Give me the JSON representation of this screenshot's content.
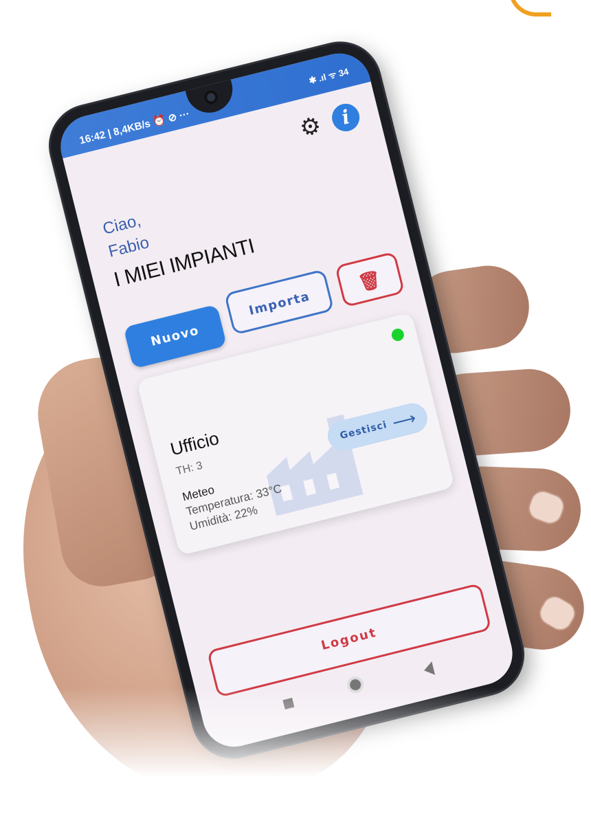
{
  "statusbar": {
    "time": "16:42 | 8,4KB/s ⏰ ⊘ ···",
    "icons": "✱ .ıl ᯤ 34"
  },
  "header": {
    "settings_icon": "gear-icon",
    "info_icon": "info-icon",
    "info_glyph": "i"
  },
  "greeting": {
    "hello": "Ciao,",
    "user": "Fabio"
  },
  "page_title": "I MIEI IMPIANTI",
  "actions": {
    "new_label": "Nuovo",
    "import_label": "Importa",
    "delete_icon": "trash-icon",
    "delete_glyph": "🗑"
  },
  "plants": [
    {
      "name": "Ufficio",
      "th": "TH: 3",
      "meteo_label": "Meteo",
      "temperature": "Temperatura: 33°C",
      "humidity": "Umidità: 22%",
      "status_color": "#19d32c",
      "manage_label": "Gestisci",
      "manage_arrow": "⟶"
    }
  ],
  "logout_label": "Logout",
  "colors": {
    "primary": "#2f7fe0",
    "danger": "#d03a44",
    "online": "#19d32c"
  }
}
